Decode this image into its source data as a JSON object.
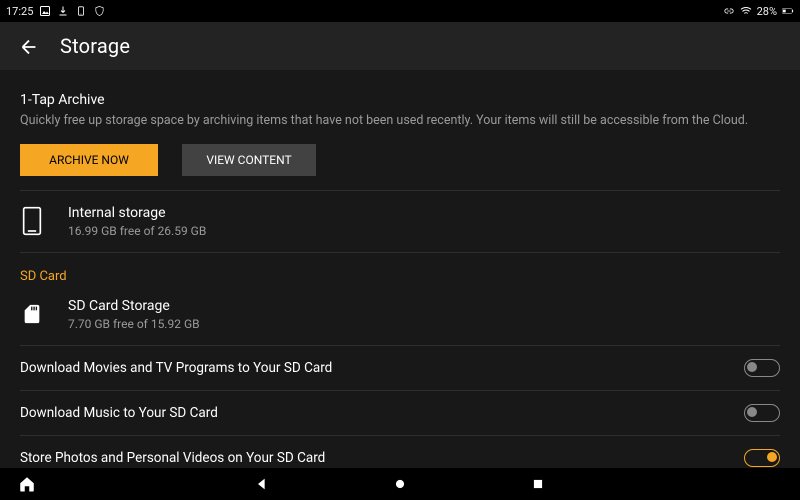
{
  "statusbar": {
    "time": "17:25",
    "battery_pct": "28%"
  },
  "titlebar": {
    "title": "Storage"
  },
  "archive": {
    "title": "1-Tap Archive",
    "description": "Quickly free up storage space by archiving items that have not been used recently. Your items will still be accessible from the Cloud.",
    "btn_archive": "ARCHIVE NOW",
    "btn_view": "VIEW CONTENT"
  },
  "internal": {
    "label": "Internal storage",
    "detail": "16.99 GB free of 26.59 GB"
  },
  "sd_category": "SD Card",
  "sdcard": {
    "label": "SD Card Storage",
    "detail": "7.70 GB free of 15.92 GB"
  },
  "toggles": {
    "movies": {
      "label": "Download Movies and TV Programs to Your SD Card",
      "on": false
    },
    "music": {
      "label": "Download Music to Your SD Card",
      "on": false
    },
    "photos": {
      "label": "Store Photos and Personal Videos on Your SD Card",
      "on": true
    }
  }
}
